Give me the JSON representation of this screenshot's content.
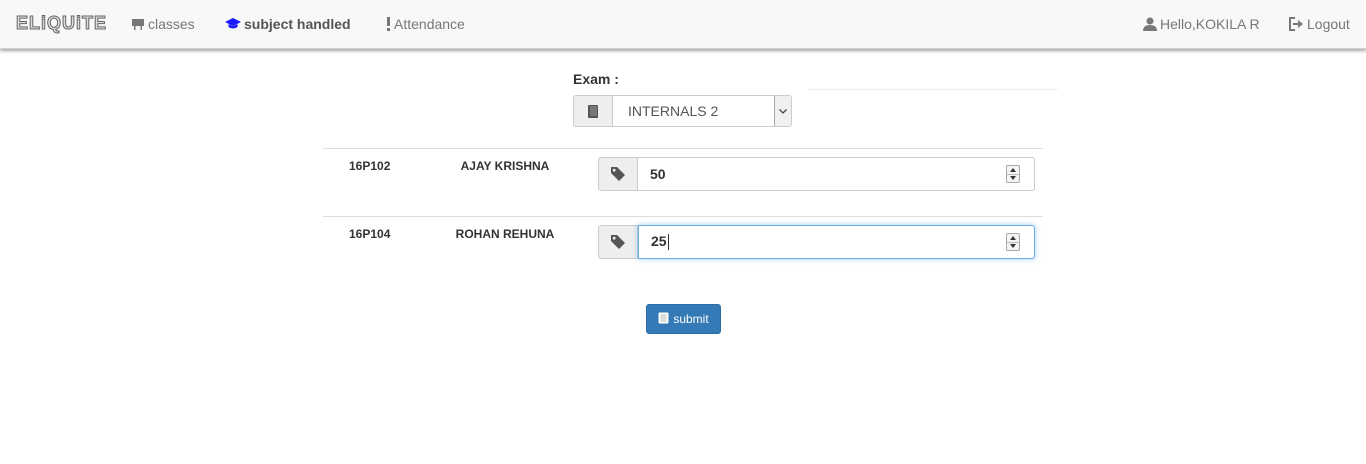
{
  "navbar": {
    "brand": "ELiQUiTE",
    "links": [
      {
        "label": "classes",
        "icon": "blackboard-icon"
      },
      {
        "label": "subject handled",
        "icon": "graduation-cap-icon"
      },
      {
        "label": "Attendance",
        "icon": "exclamation-icon"
      }
    ],
    "user": {
      "label": "Hello,KOKILA R",
      "icon": "user-icon"
    },
    "logout": {
      "label": "Logout",
      "icon": "logout-icon"
    }
  },
  "exam": {
    "label": "Exam :",
    "selected": "INTERNALS 2",
    "icon": "book-icon"
  },
  "students": [
    {
      "roll": "16P102",
      "name": "AJAY KRISHNA",
      "mark": "50"
    },
    {
      "roll": "16P104",
      "name": "ROHAN REHUNA",
      "mark": "25"
    }
  ],
  "submit": {
    "label": "submit",
    "icon": "book-icon"
  },
  "colors": {
    "primary": "#337ab7",
    "navbar_bg": "#f8f8f8",
    "focus": "#66afe9",
    "active_nav_icon": "#1a1aff"
  }
}
